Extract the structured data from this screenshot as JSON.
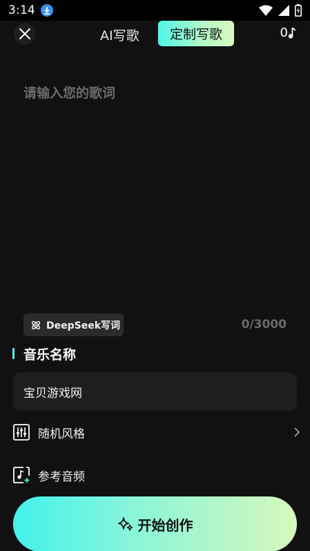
{
  "status_bar": {
    "time": "3:14",
    "icons": [
      "download-icon",
      "wifi-icon",
      "signal-icon",
      "battery-charging-icon"
    ]
  },
  "header": {
    "close_icon": "close-icon",
    "tab_ai": "AI写歌",
    "tab_custom": "定制写歌",
    "notes_count": "0",
    "notes_icon": "music-note-icon"
  },
  "lyrics": {
    "placeholder": "请输入您的歌词",
    "value": "",
    "counter": "0/3000",
    "deepseek_label": "DeepSeek写词"
  },
  "music_name": {
    "title": "音乐名称",
    "value": "宝贝游戏网"
  },
  "options": {
    "style_label": "随机风格",
    "reference_label": "参考音频"
  },
  "start_button": {
    "label": "开始创作"
  },
  "colors": {
    "accent": "#4ff5ea",
    "gradient_end": "#d7f7bd",
    "background": "#111111"
  }
}
